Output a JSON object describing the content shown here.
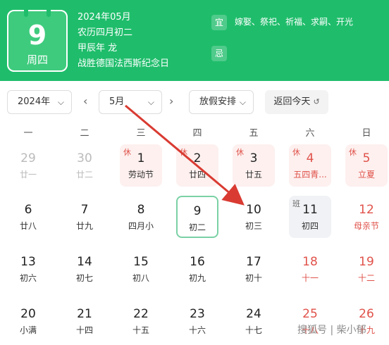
{
  "header": {
    "day": "9",
    "weekday": "周四",
    "date_line": "2024年05月",
    "lunar_line": "农历四月初二",
    "ganzhi_line": "甲辰年 龙",
    "event_line": "战胜德国法西斯纪念日",
    "yi_label": "宜",
    "yi_text": "嫁娶、祭祀、祈福、求嗣、开光",
    "ji_label": "忌"
  },
  "controls": {
    "year": "2024年",
    "month": "5月",
    "holiday": "放假安排",
    "today": "返回今天",
    "prev": "‹",
    "next": "›"
  },
  "weekdays": [
    "一",
    "二",
    "三",
    "四",
    "五",
    "六",
    "日"
  ],
  "weeks": [
    [
      {
        "num": "29",
        "lunar": "廿一",
        "type": "dim"
      },
      {
        "num": "30",
        "lunar": "廿二",
        "type": "dim"
      },
      {
        "num": "1",
        "lunar": "劳动节",
        "type": "holiday",
        "badge": "休"
      },
      {
        "num": "2",
        "lunar": "廿四",
        "type": "holiday",
        "badge": "休"
      },
      {
        "num": "3",
        "lunar": "廿五",
        "type": "holiday",
        "badge": "休"
      },
      {
        "num": "4",
        "lunar": "五四青...",
        "type": "holiday-red",
        "badge": "休"
      },
      {
        "num": "5",
        "lunar": "立夏",
        "type": "holiday-red",
        "badge": "休"
      }
    ],
    [
      {
        "num": "6",
        "lunar": "廿八",
        "type": "normal"
      },
      {
        "num": "7",
        "lunar": "廿九",
        "type": "normal"
      },
      {
        "num": "8",
        "lunar": "四月小",
        "type": "normal"
      },
      {
        "num": "9",
        "lunar": "初二",
        "type": "selected"
      },
      {
        "num": "10",
        "lunar": "初三",
        "type": "normal"
      },
      {
        "num": "11",
        "lunar": "初四",
        "type": "work",
        "badge": "班"
      },
      {
        "num": "12",
        "lunar": "母亲节",
        "type": "weekend-num"
      }
    ],
    [
      {
        "num": "13",
        "lunar": "初六",
        "type": "normal"
      },
      {
        "num": "14",
        "lunar": "初七",
        "type": "normal"
      },
      {
        "num": "15",
        "lunar": "初八",
        "type": "normal"
      },
      {
        "num": "16",
        "lunar": "初九",
        "type": "normal"
      },
      {
        "num": "17",
        "lunar": "初十",
        "type": "normal"
      },
      {
        "num": "18",
        "lunar": "十一",
        "type": "weekend-num"
      },
      {
        "num": "19",
        "lunar": "十二",
        "type": "weekend-num"
      }
    ],
    [
      {
        "num": "20",
        "lunar": "小满",
        "type": "normal"
      },
      {
        "num": "21",
        "lunar": "十四",
        "type": "normal"
      },
      {
        "num": "22",
        "lunar": "十五",
        "type": "normal"
      },
      {
        "num": "23",
        "lunar": "十六",
        "type": "normal"
      },
      {
        "num": "24",
        "lunar": "十七",
        "type": "normal"
      },
      {
        "num": "25",
        "lunar": "十八",
        "type": "weekend-num"
      },
      {
        "num": "26",
        "lunar": "十九",
        "type": "weekend-num"
      }
    ]
  ],
  "watermark": "搜狐号 | 柴小郁",
  "colors": {
    "header_green": "#1fbd6b",
    "holiday_red": "#e0524a",
    "selected_border": "#7bd1a6",
    "arrow_red": "#d93b32"
  }
}
